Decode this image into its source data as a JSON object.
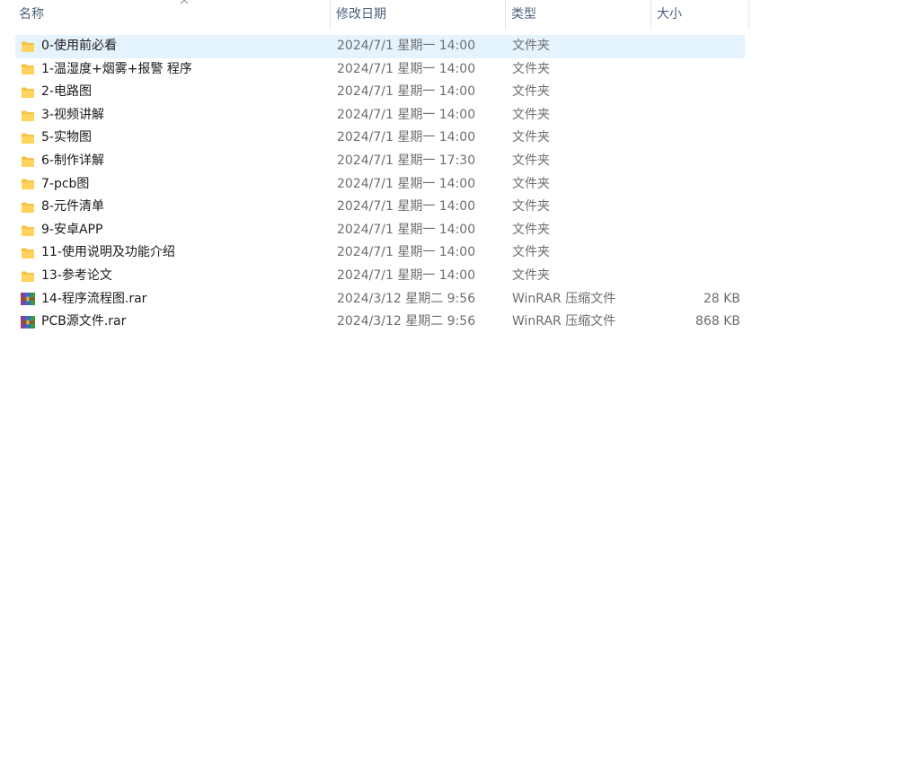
{
  "columns": {
    "name": "名称",
    "date": "修改日期",
    "type": "类型",
    "size": "大小"
  },
  "colors": {
    "selection": "#cce8ff",
    "header_text": "#4c607a",
    "secondary_text": "#6d6d6d",
    "folder": "#f5c242"
  },
  "files": [
    {
      "icon": "folder-icon",
      "name": "0-使用前必看",
      "date": "2024/7/1 星期一 14:00",
      "type": "文件夹",
      "size": "",
      "selected": true
    },
    {
      "icon": "folder-icon",
      "name": "1-温湿度+烟雾+报警 程序",
      "date": "2024/7/1 星期一 14:00",
      "type": "文件夹",
      "size": ""
    },
    {
      "icon": "folder-icon",
      "name": "2-电路图",
      "date": "2024/7/1 星期一 14:00",
      "type": "文件夹",
      "size": ""
    },
    {
      "icon": "folder-icon",
      "name": "3-视频讲解",
      "date": "2024/7/1 星期一 14:00",
      "type": "文件夹",
      "size": ""
    },
    {
      "icon": "folder-icon",
      "name": "5-实物图",
      "date": "2024/7/1 星期一 14:00",
      "type": "文件夹",
      "size": ""
    },
    {
      "icon": "folder-icon",
      "name": "6-制作详解",
      "date": "2024/7/1 星期一 17:30",
      "type": "文件夹",
      "size": ""
    },
    {
      "icon": "folder-icon",
      "name": "7-pcb图",
      "date": "2024/7/1 星期一 14:00",
      "type": "文件夹",
      "size": ""
    },
    {
      "icon": "folder-icon",
      "name": "8-元件清单",
      "date": "2024/7/1 星期一 14:00",
      "type": "文件夹",
      "size": ""
    },
    {
      "icon": "folder-icon",
      "name": "9-安卓APP",
      "date": "2024/7/1 星期一 14:00",
      "type": "文件夹",
      "size": ""
    },
    {
      "icon": "folder-icon",
      "name": "11-使用说明及功能介绍",
      "date": "2024/7/1 星期一 14:00",
      "type": "文件夹",
      "size": ""
    },
    {
      "icon": "folder-icon",
      "name": "13-参考论文",
      "date": "2024/7/1 星期一 14:00",
      "type": "文件夹",
      "size": ""
    },
    {
      "icon": "rar-archive-icon",
      "name": "14-程序流程图.rar",
      "date": "2024/3/12 星期二 9:56",
      "type": "WinRAR 压缩文件",
      "size": "28 KB"
    },
    {
      "icon": "rar-archive-icon",
      "name": "PCB源文件.rar",
      "date": "2024/3/12 星期二 9:56",
      "type": "WinRAR 压缩文件",
      "size": "868 KB"
    }
  ]
}
